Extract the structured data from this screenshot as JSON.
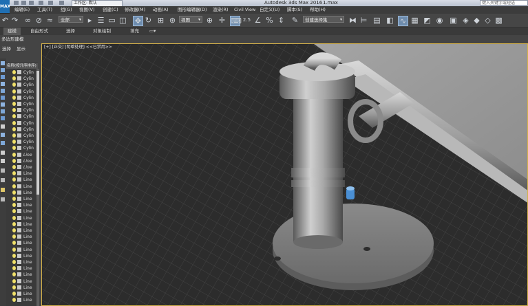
{
  "app": {
    "logo_text": "MAX",
    "workspace_label": "工作区: 默认",
    "title": "Autodesk 3ds Max 2016",
    "file": "1.max",
    "search_placeholder": "键入关键字或短语"
  },
  "menu": [
    "编辑(E)",
    "工具(T)",
    "组(G)",
    "视图(V)",
    "创建(C)",
    "修改器(M)",
    "动画(A)",
    "图形编辑器(D)",
    "渲染(R)",
    "Civil View",
    "自定义(U)",
    "脚本(S)",
    "帮助(H)"
  ],
  "toolbar": {
    "selection_filter": "全部",
    "reference_coord": "视图",
    "snap_label": "2.5",
    "named_selection": "创建选择集"
  },
  "ribbon": {
    "tabs": [
      "建模",
      "自由形式",
      "选择",
      "对象绘制",
      "填充"
    ],
    "active_tab": "建模",
    "sub_label": "多边形建模"
  },
  "scene_explorer": {
    "tabs": [
      "选择",
      "显示"
    ],
    "header": "名称(按升序排序)",
    "rows": [
      {
        "name": "Cylin",
        "italic": false
      },
      {
        "name": "Cylin",
        "italic": false
      },
      {
        "name": "Cylin",
        "italic": false
      },
      {
        "name": "Cylin",
        "italic": false
      },
      {
        "name": "Cylin",
        "italic": false
      },
      {
        "name": "Cylin",
        "italic": false
      },
      {
        "name": "Cylin",
        "italic": false
      },
      {
        "name": "Cylin",
        "italic": false
      },
      {
        "name": "Cylin",
        "italic": false
      },
      {
        "name": "Cylin",
        "italic": false
      },
      {
        "name": "Cylin",
        "italic": false
      },
      {
        "name": "Cylin",
        "italic": false
      },
      {
        "name": "Cylin",
        "italic": false
      },
      {
        "name": "Line",
        "italic": true
      },
      {
        "name": "Line",
        "italic": true
      },
      {
        "name": "Line",
        "italic": true
      },
      {
        "name": "Line",
        "italic": false
      },
      {
        "name": "Line",
        "italic": false
      },
      {
        "name": "Line",
        "italic": false
      },
      {
        "name": "Line",
        "italic": false
      },
      {
        "name": "Line",
        "italic": false
      },
      {
        "name": "Line",
        "italic": false
      },
      {
        "name": "Line",
        "italic": false
      },
      {
        "name": "Line",
        "italic": false
      },
      {
        "name": "Line",
        "italic": false
      },
      {
        "name": "Line",
        "italic": false
      },
      {
        "name": "Line",
        "italic": false
      },
      {
        "name": "Line",
        "italic": false
      },
      {
        "name": "Line",
        "italic": false
      },
      {
        "name": "Line",
        "italic": false
      },
      {
        "name": "Line",
        "italic": false
      },
      {
        "name": "Line",
        "italic": false
      },
      {
        "name": "Line",
        "italic": false
      },
      {
        "name": "Line",
        "italic": false
      },
      {
        "name": "Line",
        "italic": false
      },
      {
        "name": "Line",
        "italic": false
      },
      {
        "name": "Line",
        "italic": false
      }
    ]
  },
  "viewport": {
    "label": "[+] [正交] [明暗处理] <<已禁用>>"
  },
  "colors": {
    "active_border": "#d4b14a",
    "selection_highlight": "#6e8cad",
    "accent_blue": "#4a8fd4"
  }
}
